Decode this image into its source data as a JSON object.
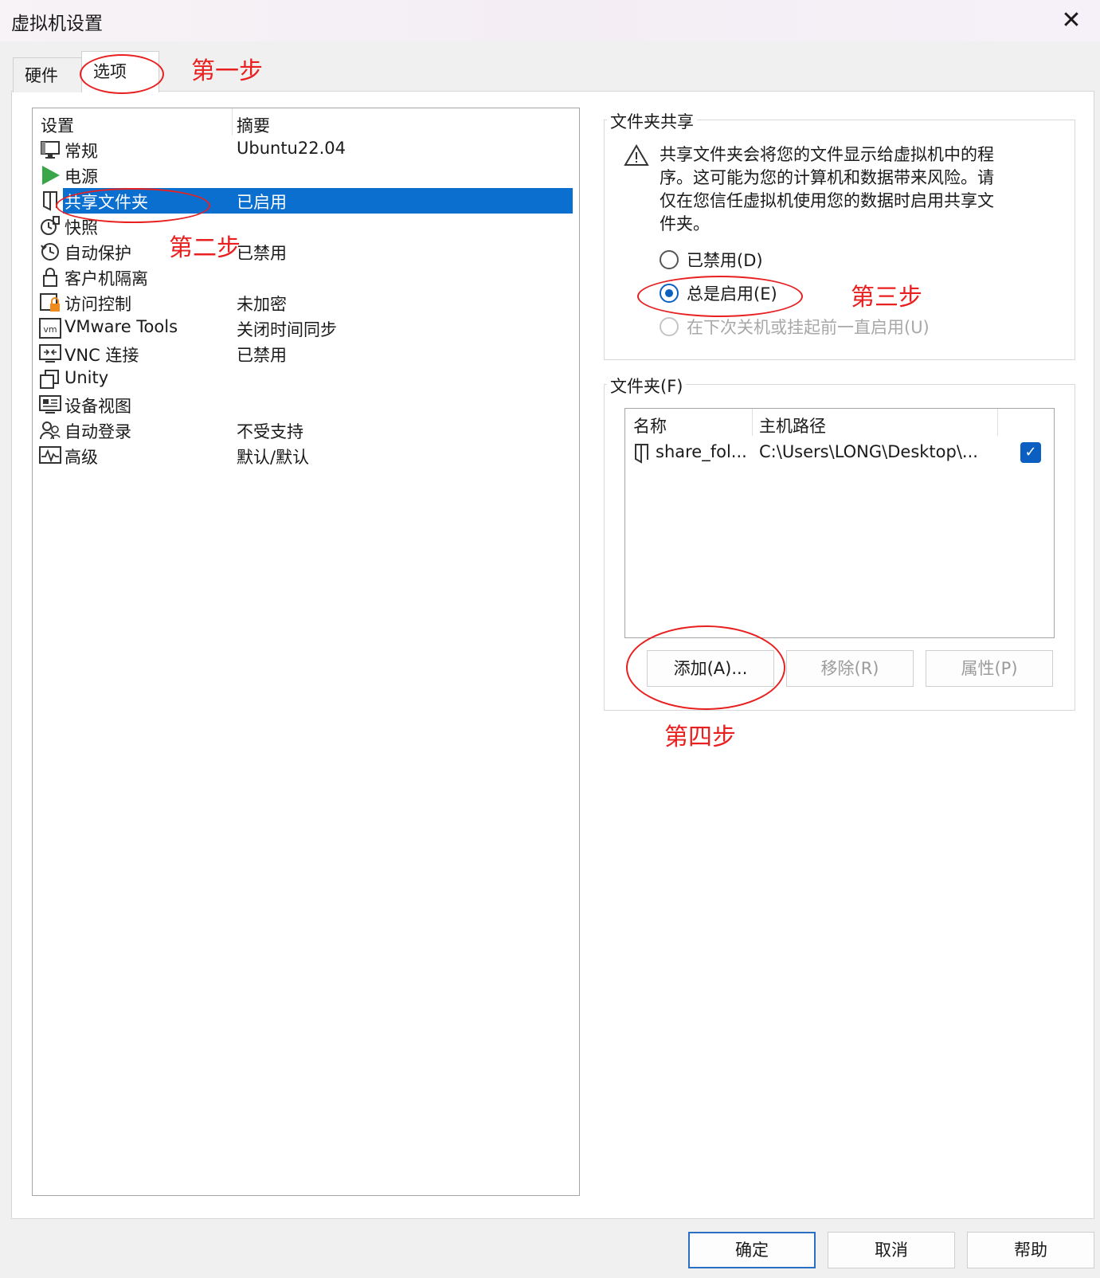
{
  "window": {
    "title": "虚拟机设置"
  },
  "tabs": [
    {
      "label": "硬件"
    },
    {
      "label": "选项",
      "active": true
    }
  ],
  "settings": {
    "columns": {
      "setting": "设置",
      "summary": "摘要"
    },
    "items": [
      {
        "label": "常规",
        "summary": "Ubuntu22.04",
        "icon": "monitor-icon"
      },
      {
        "label": "电源",
        "summary": "",
        "icon": "play-icon"
      },
      {
        "label": "共享文件夹",
        "summary": "已启用",
        "icon": "shared-folder-icon",
        "selected": true
      },
      {
        "label": "快照",
        "summary": "",
        "icon": "snapshot-icon"
      },
      {
        "label": "自动保护",
        "summary": "已禁用",
        "icon": "clock-icon"
      },
      {
        "label": "客户机隔离",
        "summary": "",
        "icon": "lock-icon"
      },
      {
        "label": "访问控制",
        "summary": "未加密",
        "icon": "access-control-icon"
      },
      {
        "label": "VMware Tools",
        "summary": "关闭时间同步",
        "icon": "vm-icon"
      },
      {
        "label": "VNC 连接",
        "summary": "已禁用",
        "icon": "vnc-icon"
      },
      {
        "label": "Unity",
        "summary": "",
        "icon": "unity-icon"
      },
      {
        "label": "设备视图",
        "summary": "",
        "icon": "device-view-icon"
      },
      {
        "label": "自动登录",
        "summary": "不受支持",
        "icon": "users-icon"
      },
      {
        "label": "高级",
        "summary": "默认/默认",
        "icon": "pulse-icon"
      }
    ]
  },
  "folder_sharing": {
    "title": "文件夹共享",
    "warning": "共享文件夹会将您的文件显示给虚拟机中的程序。这可能为您的计算机和数据带来风险。请仅在您信任虚拟机使用您的数据时启用共享文件夹。",
    "options": [
      {
        "label": "已禁用(D)",
        "selected": false,
        "enabled": true
      },
      {
        "label": "总是启用(E)",
        "selected": true,
        "enabled": true
      },
      {
        "label": "在下次关机或挂起前一直启用(U)",
        "selected": false,
        "enabled": false
      }
    ]
  },
  "folders": {
    "title": "文件夹(F)",
    "columns": {
      "name": "名称",
      "path": "主机路径"
    },
    "rows": [
      {
        "name": "share_fol...",
        "path": "C:\\Users\\LONG\\Desktop\\...",
        "checked": true
      }
    ],
    "buttons": {
      "add": "添加(A)...",
      "remove": "移除(R)",
      "properties": "属性(P)"
    }
  },
  "dialog_buttons": {
    "ok": "确定",
    "cancel": "取消",
    "help": "帮助"
  },
  "annotations": {
    "step1": "第一步",
    "step2": "第二步",
    "step3": "第三步",
    "step4": "第四步"
  },
  "colors": {
    "selection": "#0b6fd0",
    "accent": "#0b5fc0",
    "annotation": "#e82020"
  }
}
